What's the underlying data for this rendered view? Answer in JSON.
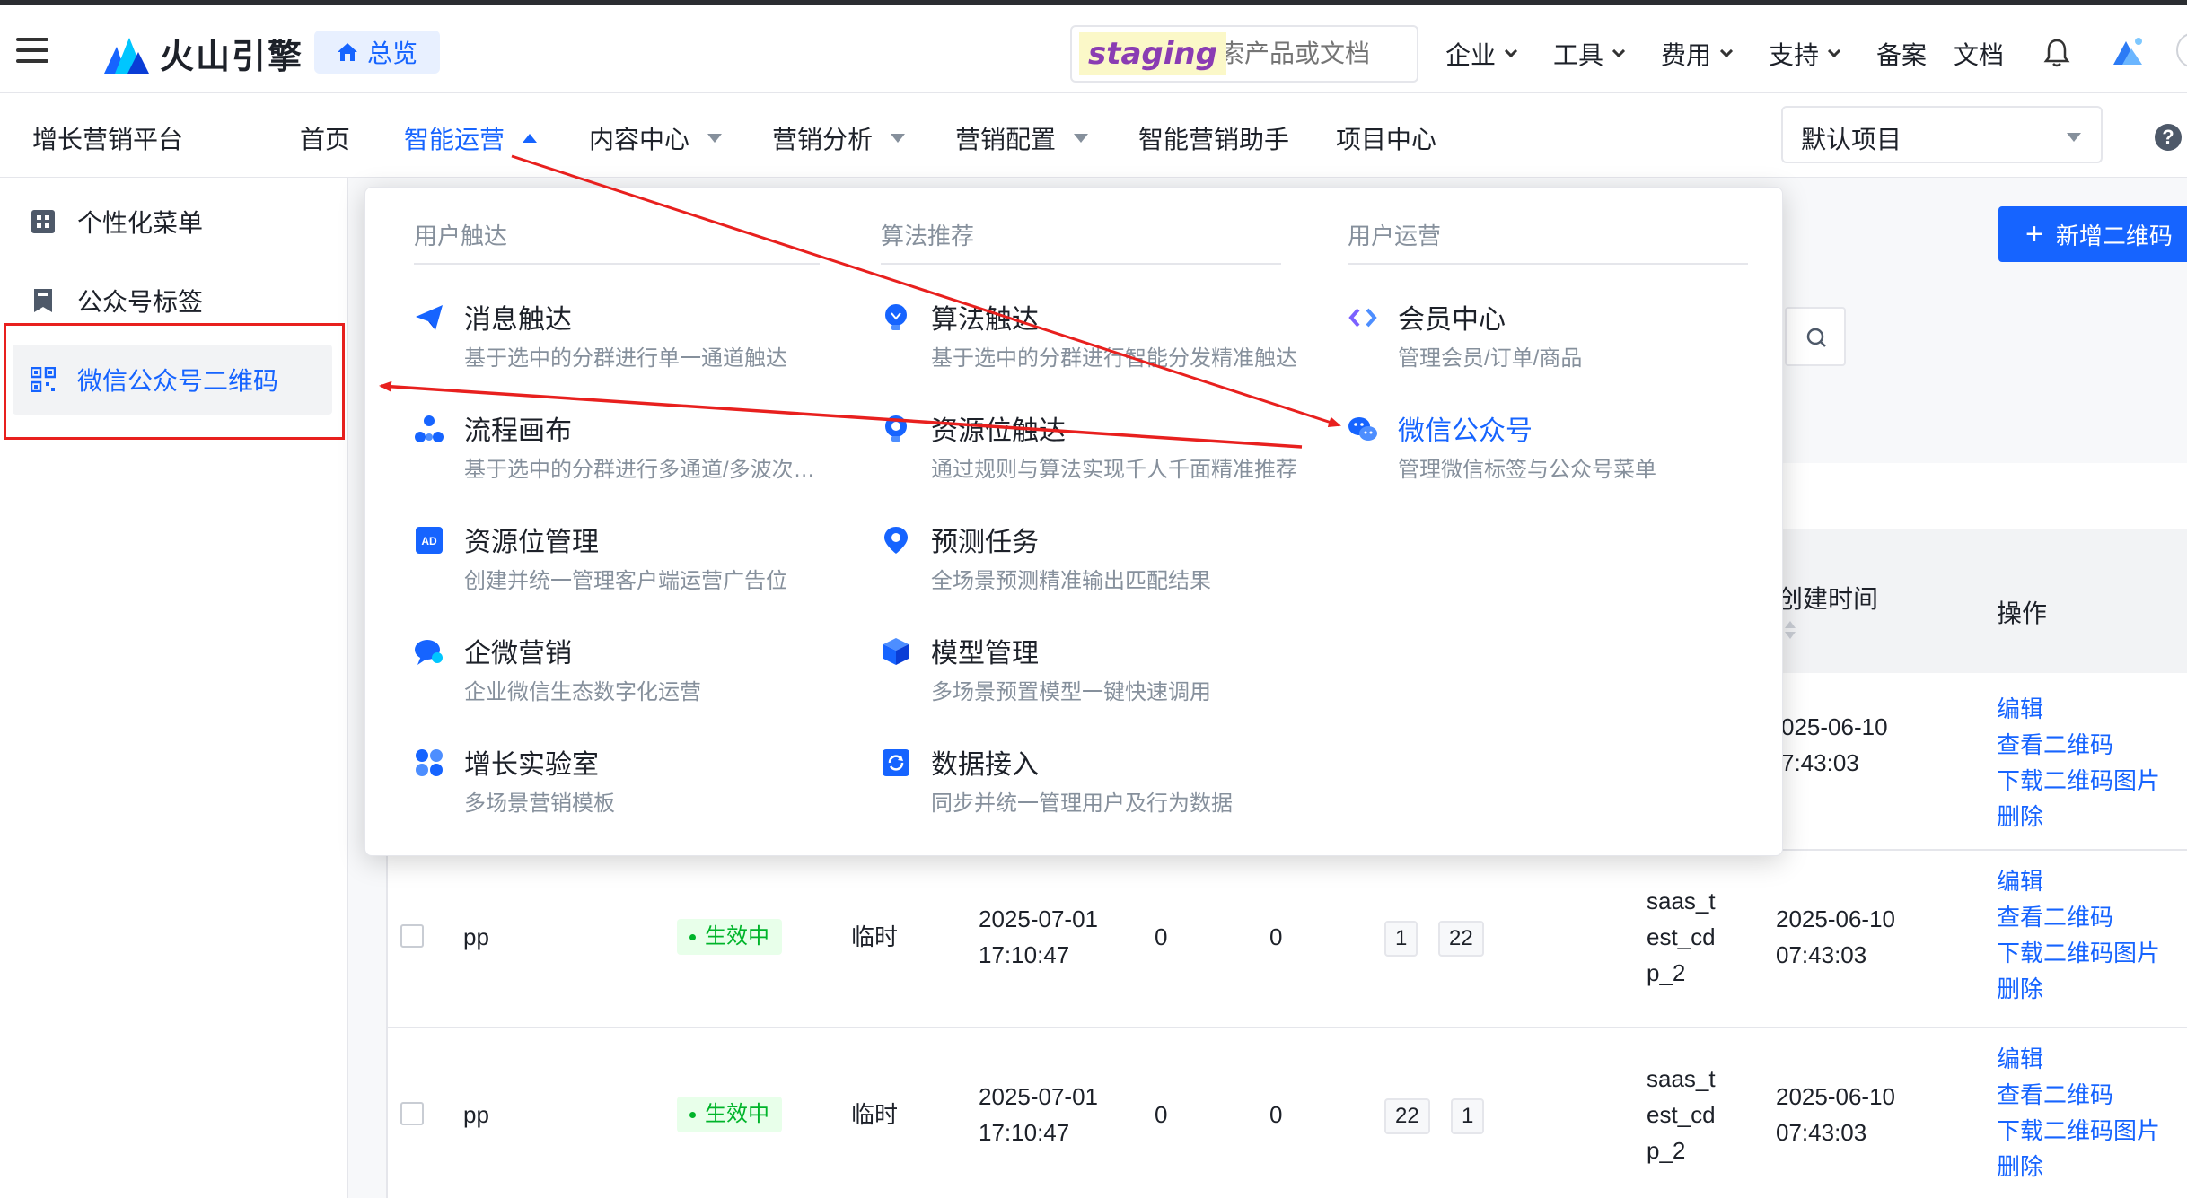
{
  "topbar": {
    "brand": "火山引擎",
    "overview_label": "总览",
    "staging_label": "staging",
    "search_placeholder": "搜索产品或文档",
    "nav": [
      {
        "label": "企业"
      },
      {
        "label": "工具"
      },
      {
        "label": "费用"
      },
      {
        "label": "支持"
      },
      {
        "label": "备案"
      },
      {
        "label": "文档"
      }
    ]
  },
  "subnav": {
    "platform": "增长营销平台",
    "items": [
      {
        "label": "首页"
      },
      {
        "label": "智能运营"
      },
      {
        "label": "内容中心"
      },
      {
        "label": "营销分析"
      },
      {
        "label": "营销配置"
      },
      {
        "label": "智能营销助手"
      },
      {
        "label": "项目中心"
      }
    ],
    "project_select": "默认项目",
    "help": "?"
  },
  "sidebar": {
    "items": [
      {
        "label": "个性化菜单"
      },
      {
        "label": "公众号标签"
      },
      {
        "label": "微信公众号二维码"
      }
    ]
  },
  "main": {
    "new_button": "新增二维码",
    "new_button_plus": "+",
    "table": {
      "headers": {
        "created": "创建时间",
        "ops": "操作"
      },
      "rows": [
        {
          "name": "",
          "status": "",
          "type": "",
          "time": "",
          "c1": "",
          "c2": "",
          "tags": [],
          "owner": "",
          "created": [
            "025-06-10",
            "7:43:03"
          ],
          "ops": [
            "编辑",
            "查看二维码",
            "下载二维码图片",
            "删除"
          ]
        },
        {
          "name": "pp",
          "status": "生效中",
          "type": "临时",
          "time": [
            "2025-07-01",
            "17:10:47"
          ],
          "c1": "0",
          "c2": "0",
          "tags": [
            "1",
            "22"
          ],
          "owner": [
            "saas_t",
            "est_cd",
            "p_2"
          ],
          "created": [
            "2025-06-10",
            "07:43:03"
          ],
          "ops": [
            "编辑",
            "查看二维码",
            "下载二维码图片",
            "删除"
          ]
        },
        {
          "name": "pp",
          "status": "生效中",
          "type": "临时",
          "time": [
            "2025-07-01",
            "17:10:47"
          ],
          "c1": "0",
          "c2": "0",
          "tags": [
            "22",
            "1"
          ],
          "owner": [
            "saas_t",
            "est_cd",
            "p_2"
          ],
          "created": [
            "2025-06-10",
            "07:43:03"
          ],
          "ops": [
            "编辑",
            "查看二维码",
            "下载二维码图片",
            "删除"
          ]
        }
      ]
    }
  },
  "dropdown": {
    "columns": [
      {
        "title": "用户触达",
        "entries": [
          {
            "title": "消息触达",
            "desc": "基于选中的分群进行单一通道触达",
            "icon": "paper-plane-icon"
          },
          {
            "title": "流程画布",
            "desc": "基于选中的分群进行多通道/多波次触达",
            "icon": "flow-nodes-icon"
          },
          {
            "title": "资源位管理",
            "desc": "创建并统一管理客户端运营广告位",
            "icon": "ad-icon"
          },
          {
            "title": "企微营销",
            "desc": "企业微信生态数字化运营",
            "icon": "chat-bubble-icon"
          },
          {
            "title": "增长实验室",
            "desc": "多场景营销模板",
            "icon": "grid-dots-icon"
          }
        ]
      },
      {
        "title": "算法推荐",
        "entries": [
          {
            "title": "算法触达",
            "desc": "基于选中的分群进行智能分发精准触达",
            "icon": "bulb-icon"
          },
          {
            "title": "资源位触达",
            "desc": "通过规则与算法实现千人千面精准推荐",
            "icon": "target-icon"
          },
          {
            "title": "预测任务",
            "desc": "全场景预测精准输出匹配结果",
            "icon": "location-icon"
          },
          {
            "title": "模型管理",
            "desc": "多场景预置模型一键快速调用",
            "icon": "cube-icon"
          },
          {
            "title": "数据接入",
            "desc": "同步并统一管理用户及行为数据",
            "icon": "sync-icon"
          }
        ]
      },
      {
        "title": "用户运营",
        "entries": [
          {
            "title": "会员中心",
            "desc": "管理会员/订单/商品",
            "icon": "member-icon"
          },
          {
            "title": "微信公众号",
            "desc": "管理微信标签与公众号菜单",
            "icon": "wechat-icon"
          }
        ]
      }
    ]
  },
  "colors": {
    "primary": "#1664ff",
    "annotation_red": "#e8201e",
    "success": "#00b42a"
  }
}
